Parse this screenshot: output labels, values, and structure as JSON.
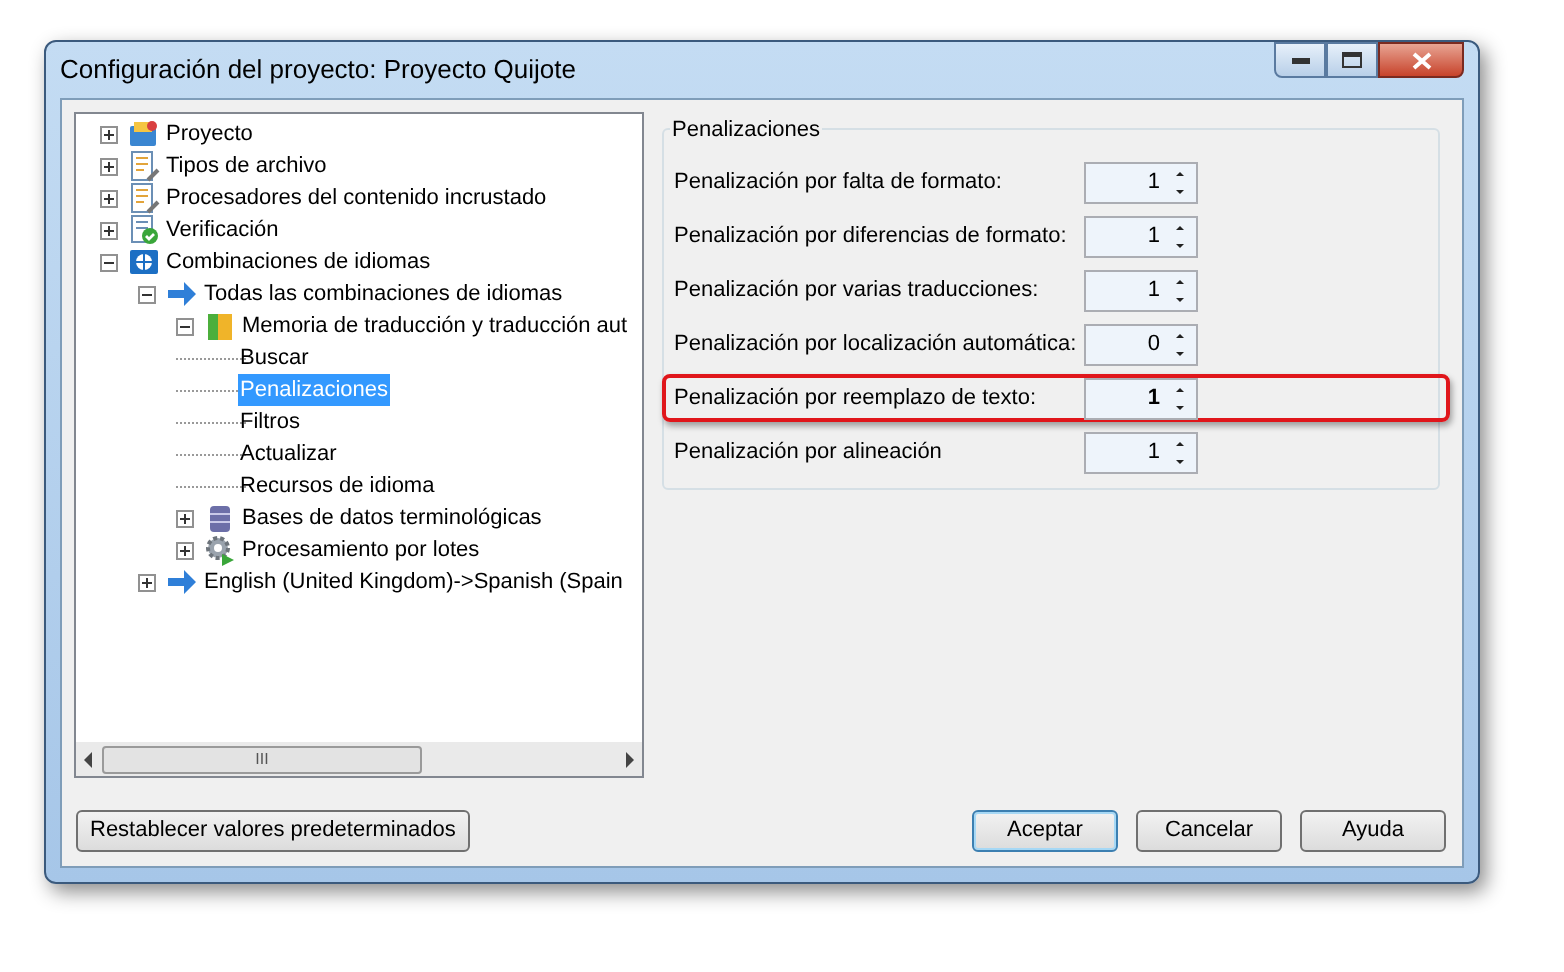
{
  "window": {
    "title": "Configuración del proyecto: Proyecto Quijote"
  },
  "tree": [
    {
      "label": "Proyecto",
      "kind": "project",
      "expanded": false,
      "selected": false
    },
    {
      "label": "Tipos de archivo",
      "kind": "document",
      "expanded": false,
      "selected": false
    },
    {
      "label": "Procesadores del contenido incrustado",
      "kind": "document",
      "expanded": false,
      "selected": false
    },
    {
      "label": "Verificación",
      "kind": "check",
      "expanded": false,
      "selected": false
    },
    {
      "label": "Combinaciones de idiomas",
      "kind": "globe",
      "expanded": true,
      "selected": false,
      "children": [
        {
          "label": "Todas las combinaciones de idiomas",
          "kind": "arrow",
          "expanded": true,
          "selected": false,
          "children": [
            {
              "label": "Memoria de traducción y traducción aut",
              "kind": "memory",
              "expanded": true,
              "selected": false,
              "children": [
                {
                  "label": "Buscar",
                  "kind": "leaf",
                  "selected": false
                },
                {
                  "label": "Penalizaciones",
                  "kind": "leaf",
                  "selected": true
                },
                {
                  "label": "Filtros",
                  "kind": "leaf",
                  "selected": false
                },
                {
                  "label": "Actualizar",
                  "kind": "leaf",
                  "selected": false
                },
                {
                  "label": "Recursos de idioma",
                  "kind": "leaf",
                  "selected": false
                }
              ]
            },
            {
              "label": "Bases de datos terminológicas",
              "kind": "database",
              "expanded": false,
              "selected": false
            },
            {
              "label": "Procesamiento por lotes",
              "kind": "gear",
              "expanded": false,
              "selected": false
            }
          ]
        },
        {
          "label": "English (United Kingdom)->Spanish (Spain",
          "kind": "arrow",
          "expanded": false,
          "selected": false
        }
      ]
    }
  ],
  "scrollbar_grip": "III",
  "group": {
    "title": "Penalizaciones",
    "rows": [
      {
        "label": "Penalización por falta de formato:",
        "value": "1",
        "highlighted": false
      },
      {
        "label": "Penalización por diferencias de formato:",
        "value": "1",
        "highlighted": false
      },
      {
        "label": "Penalización por varias traducciones:",
        "value": "1",
        "highlighted": false
      },
      {
        "label": "Penalización por localización automática:",
        "value": "0",
        "highlighted": false
      },
      {
        "label": "Penalización por reemplazo de texto:",
        "value": "1",
        "highlighted": true
      },
      {
        "label": "Penalización por alineación",
        "value": "1",
        "highlighted": false
      }
    ]
  },
  "buttons": {
    "reset": "Restablecer valores predeterminados",
    "actions": [
      {
        "label": "Aceptar",
        "default": true
      },
      {
        "label": "Cancelar",
        "default": false
      },
      {
        "label": "Ayuda",
        "default": false
      }
    ]
  }
}
